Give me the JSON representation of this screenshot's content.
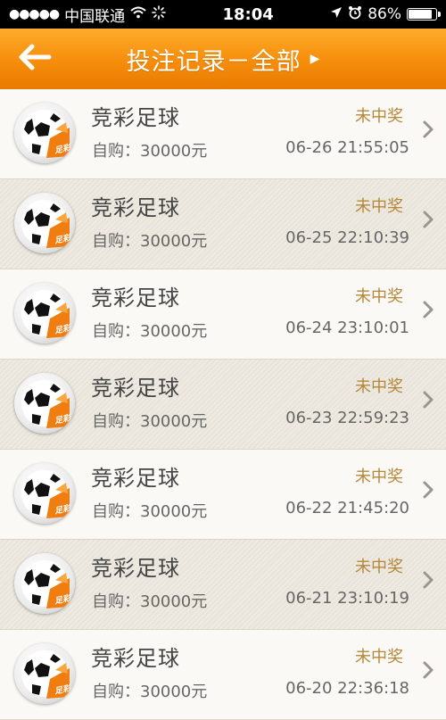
{
  "status_bar": {
    "carrier": "中国联通",
    "time": "18:04",
    "battery_label": "86%",
    "battery_level": 0.86
  },
  "nav": {
    "title": "投注记录－全部",
    "back_icon": "back-arrow-icon"
  },
  "records": [
    {
      "game": "竞彩足球",
      "logo_text": "足彩",
      "purchase": "自购：30000元",
      "status": "未中奖",
      "datetime": "06-26 21:55:05"
    },
    {
      "game": "竞彩足球",
      "logo_text": "足彩",
      "purchase": "自购：30000元",
      "status": "未中奖",
      "datetime": "06-25 22:10:39"
    },
    {
      "game": "竞彩足球",
      "logo_text": "足彩",
      "purchase": "自购：30000元",
      "status": "未中奖",
      "datetime": "06-24 23:10:01"
    },
    {
      "game": "竞彩足球",
      "logo_text": "足彩",
      "purchase": "自购：30000元",
      "status": "未中奖",
      "datetime": "06-23 22:59:23"
    },
    {
      "game": "竞彩足球",
      "logo_text": "足彩",
      "purchase": "自购：30000元",
      "status": "未中奖",
      "datetime": "06-22 21:45:20"
    },
    {
      "game": "竞彩足球",
      "logo_text": "足彩",
      "purchase": "自购：30000元",
      "status": "未中奖",
      "datetime": "06-21 23:10:19"
    },
    {
      "game": "竞彩足球",
      "logo_text": "足彩",
      "purchase": "自购：30000元",
      "status": "未中奖",
      "datetime": "06-20 22:36:18"
    }
  ],
  "colors": {
    "nav_orange": "#f58d0b",
    "status_text": "#b5873a"
  }
}
